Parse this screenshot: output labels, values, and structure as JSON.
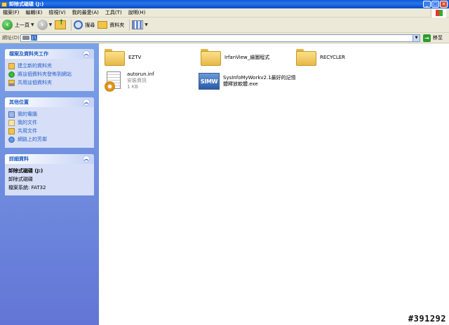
{
  "window": {
    "title": "卸除式磁碟 (J:)"
  },
  "window_buttons": {
    "minimize": "_",
    "maximize": "□",
    "close": "✕"
  },
  "menu": [
    "檔案(F)",
    "編輯(E)",
    "檢視(V)",
    "我的最愛(A)",
    "工具(T)",
    "說明(H)"
  ],
  "toolbar": {
    "back_label": "上一頁",
    "search_label": "搜尋",
    "folders_label": "資料夾"
  },
  "address": {
    "label": "網址(D)",
    "value": "J:\\",
    "go_label": "移至"
  },
  "panels": {
    "file_tasks": {
      "title": "檔案及資料夾工作",
      "items": [
        "建立新的資料夾",
        "將這個資料夾發佈到網站",
        "共用這個資料夾"
      ]
    },
    "other_places": {
      "title": "其他位置",
      "items": [
        "我的電腦",
        "我的文件",
        "共用文件",
        "網路上的芳鄰"
      ]
    },
    "details": {
      "title": "詳細資料",
      "name": "卸除式磁碟 (J:)",
      "type": "卸除式磁碟",
      "fs": "檔案系統: FAT32"
    }
  },
  "files": [
    {
      "name": "EZTV",
      "kind": "folder"
    },
    {
      "name": "IrfanView_繪圖程式",
      "kind": "folder"
    },
    {
      "name": "RECYCLER",
      "kind": "folder"
    },
    {
      "name": "autorun.inf",
      "desc": "安裝資訊",
      "size": "1 KB",
      "kind": "inf"
    },
    {
      "name_line1": "SysInfoMyWorkv2.1最好的記憶",
      "name_line2": "體釋放軟體.exe",
      "icon_text": "SIMW",
      "kind": "exe"
    }
  ],
  "watermark": "#391292"
}
